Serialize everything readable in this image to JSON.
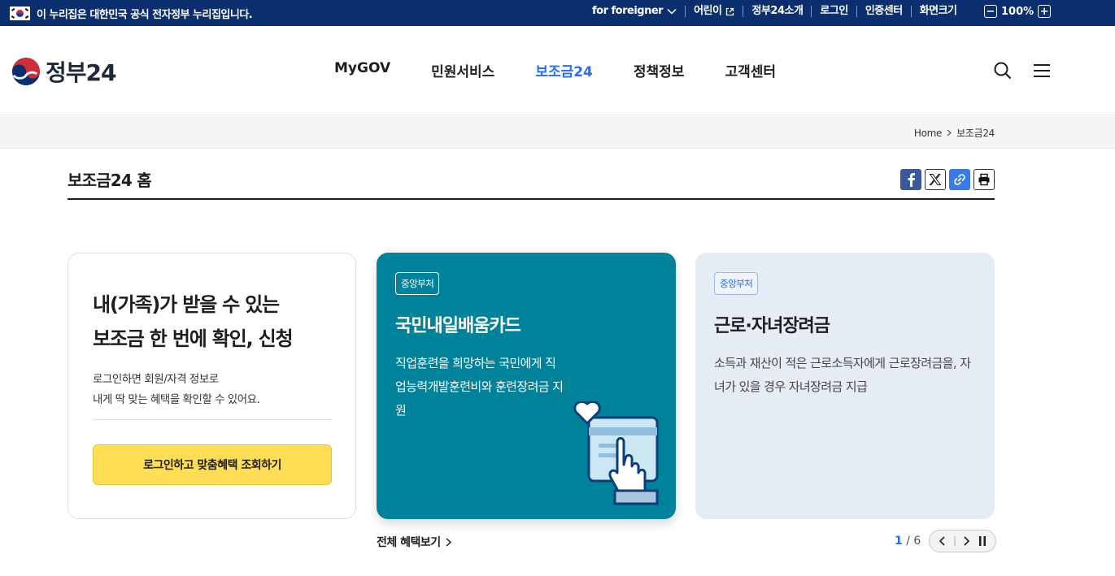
{
  "topbar": {
    "notice": "이 누리집은 대한민국 공식 전자정부 누리집입니다.",
    "links": [
      {
        "label": "for foreigner"
      },
      {
        "label": "어린이"
      },
      {
        "label": "정부24소개"
      },
      {
        "label": "로그인"
      },
      {
        "label": "인증센터"
      },
      {
        "label": "화면크기"
      }
    ],
    "zoom": "100%",
    "zoom_minus": "−",
    "zoom_plus": "+"
  },
  "header": {
    "logo": "정부24",
    "nav": [
      {
        "label": "MyGOV",
        "active": false
      },
      {
        "label": "민원서비스",
        "active": false
      },
      {
        "label": "보조금24",
        "active": true
      },
      {
        "label": "정책정보",
        "active": false
      },
      {
        "label": "고객센터",
        "active": false
      }
    ]
  },
  "breadcrumb": {
    "home": "Home",
    "current": "보조금24"
  },
  "page": {
    "title": "보조금24 홈"
  },
  "cards": {
    "login": {
      "heading_line1": "내(가족)가 받을 수 있는",
      "heading_line2": "보조금 한 번에 확인, 신청",
      "desc_line1": "로그인하면 회원/자격 정보로",
      "desc_line2": "내게 딱 맞는 혜택을 확인할 수 있어요.",
      "button": "로그인하고 맞춤혜택 조회하기"
    },
    "featured": [
      {
        "tag": "중앙부처",
        "title": "국민내일배움카드",
        "desc": "직업훈련을 희망하는 국민에게 직업능력개발훈련비와 훈련장려금 지원"
      },
      {
        "tag": "중앙부처",
        "title": "근로·자녀장려금",
        "desc": "소득과 재산이 적은 근로소득자에게 근로장려금을, 자녀가 있을 경우 자녀장려금 지급"
      }
    ]
  },
  "footer_controls": {
    "more": "전체 혜택보기",
    "page_current": "1",
    "page_sep": "/",
    "page_total": "6"
  },
  "colors": {
    "topbar": "#0a2e6e",
    "accent": "#256ef4",
    "teal": "#00839a",
    "login_button": "#ffdd55"
  }
}
